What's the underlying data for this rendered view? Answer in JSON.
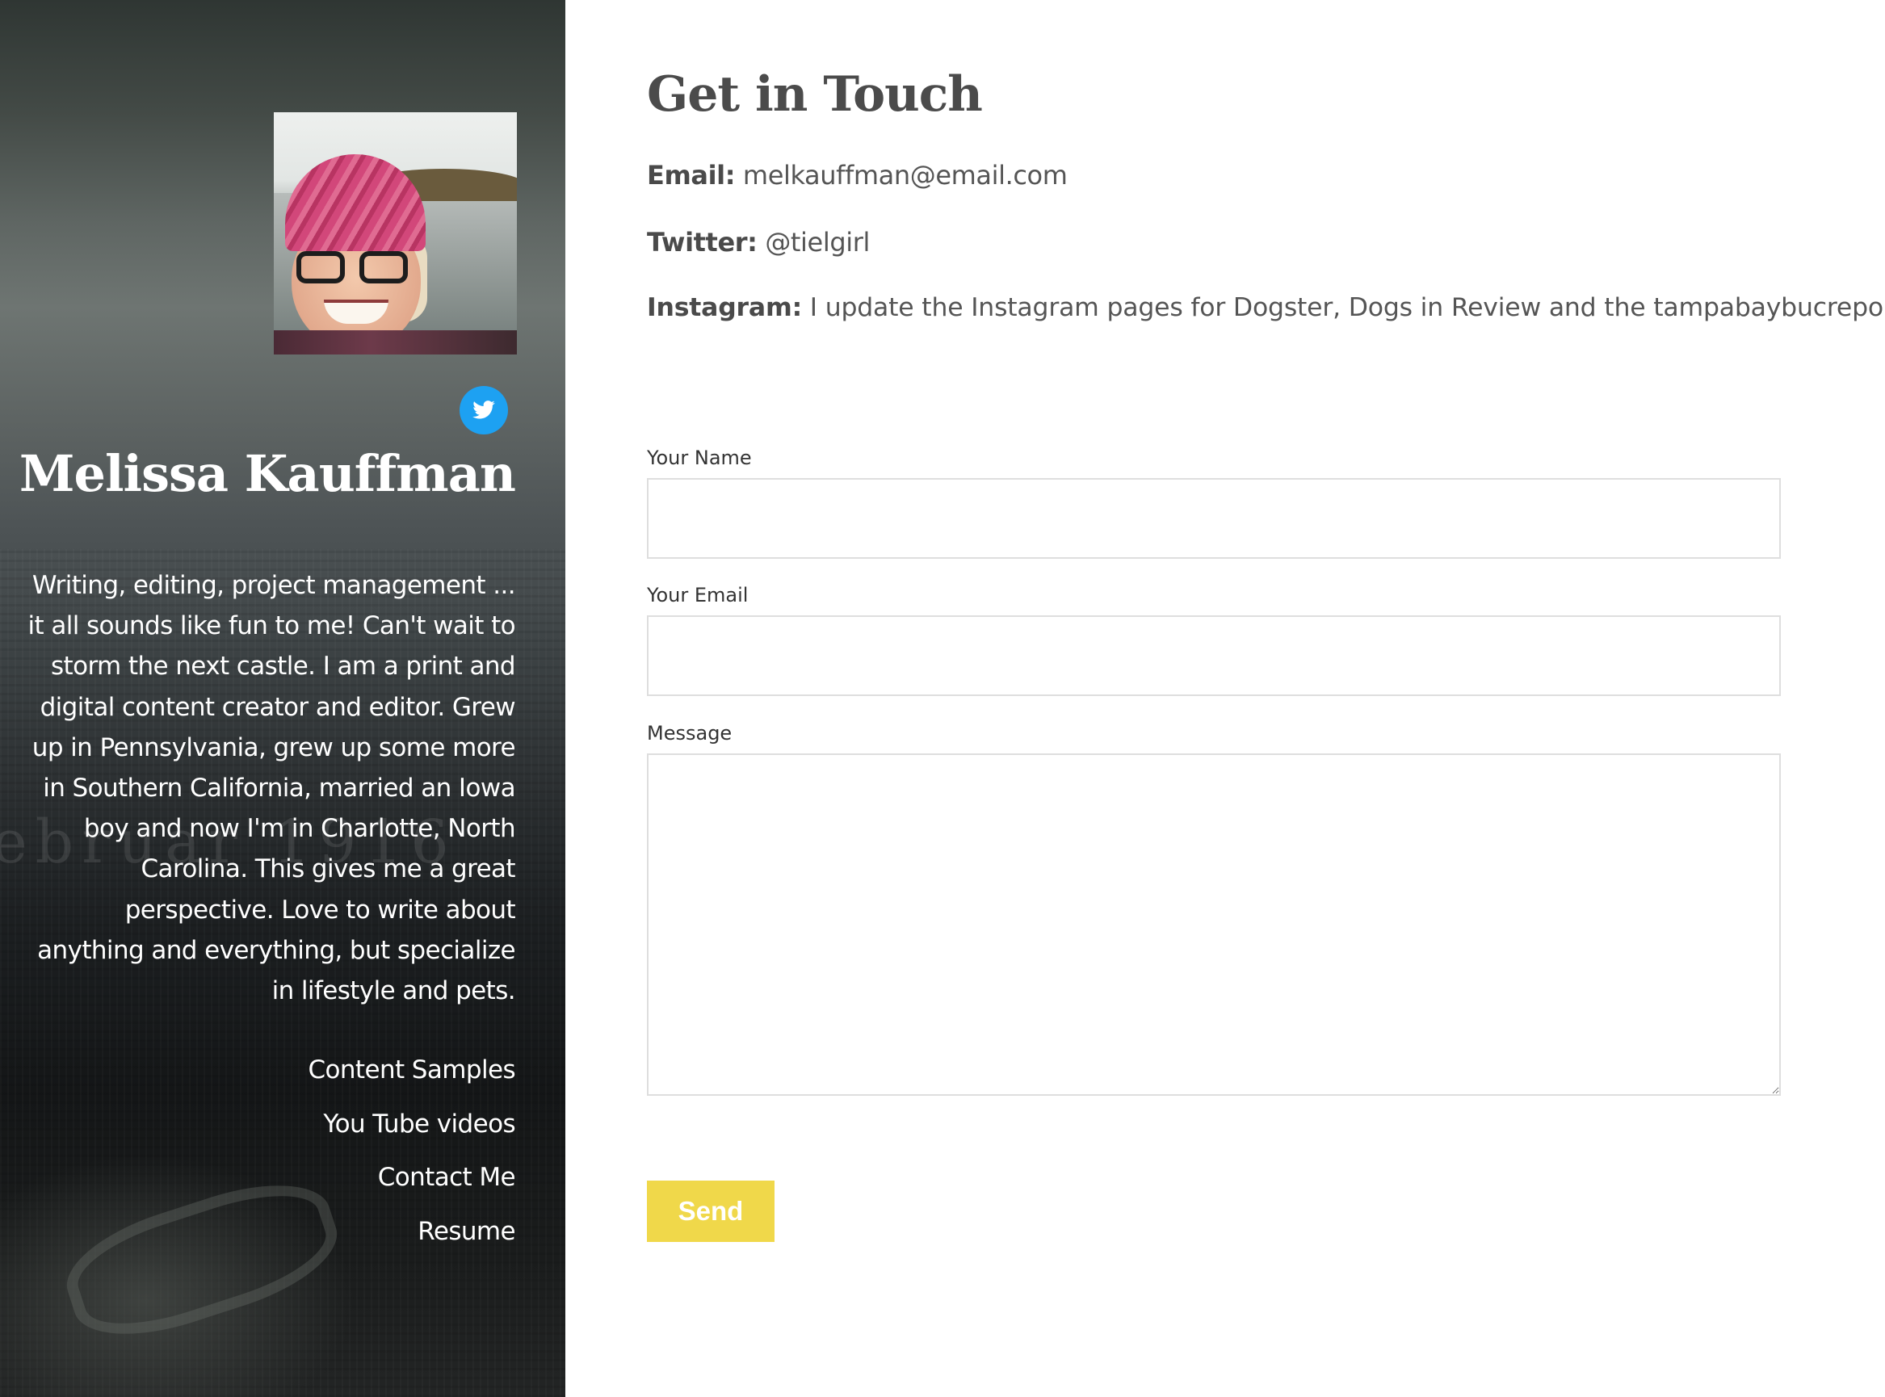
{
  "sidebar": {
    "name": "Melissa Kauffman",
    "bio": "Writing, editing, project management ... it all sounds like fun to me! Can't wait to storm the next castle. I am a print and digital content creator and editor. Grew up in Pennsylvania, grew up some more in Southern California, married an Iowa boy and now I'm in Charlotte, North Carolina. This gives me a great perspective. Love to write about anything and everything, but specialize in lifestyle and pets.",
    "social_icon": "twitter-icon",
    "nav": [
      {
        "label": "Content Samples"
      },
      {
        "label": "You Tube videos"
      },
      {
        "label": "Contact Me"
      },
      {
        "label": "Resume"
      }
    ]
  },
  "main": {
    "title": "Get in Touch",
    "email": {
      "label": "Email:",
      "value": "melkauffman@email.com"
    },
    "twitter": {
      "label": "Twitter:",
      "value": "@tielgirl"
    },
    "instagram": {
      "label": "Instagram:",
      "value": "I update the Instagram pages for Dogster, Dogs in Review and the tampabaybucreport"
    },
    "form": {
      "name_label": "Your Name",
      "name_value": "",
      "email_label": "Your Email",
      "email_value": "",
      "message_label": "Message",
      "message_value": "",
      "send_label": "Send"
    }
  },
  "colors": {
    "accent_button": "#f0d84a",
    "twitter_blue": "#1da1f2",
    "heading": "#4b4b4b"
  }
}
